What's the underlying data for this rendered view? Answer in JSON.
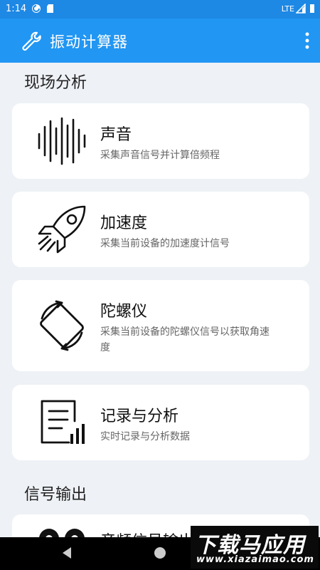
{
  "status_bar": {
    "time": "1:14",
    "network": "LTE"
  },
  "app_bar": {
    "title": "振动计算器",
    "icon": "wrench-icon",
    "menu_icon": "more-vert-icon"
  },
  "sections": [
    {
      "title": "现场分析",
      "cards": [
        {
          "title": "声音",
          "desc": "采集声音信号并计算倍频程",
          "icon": "sound-wave-icon"
        },
        {
          "title": "加速度",
          "desc": "采集当前设备的加速度计信号",
          "icon": "rocket-icon"
        },
        {
          "title": "陀螺仪",
          "desc": "采集当前设备的陀螺仪信号以获取角速度",
          "icon": "screen-rotation-icon"
        },
        {
          "title": "记录与分析",
          "desc": "实时记录与分析数据",
          "icon": "report-chart-icon"
        }
      ]
    },
    {
      "title": "信号输出",
      "cards": [
        {
          "title": "音频信号输出",
          "desc": "",
          "icon": "earbuds-icon"
        }
      ]
    }
  ],
  "watermark": {
    "text": "下载马应用",
    "url": "www.xiazaimao.com"
  },
  "colors": {
    "primary": "#2196f3",
    "status_bar": "#1e88e5",
    "background": "#eef1f5"
  }
}
